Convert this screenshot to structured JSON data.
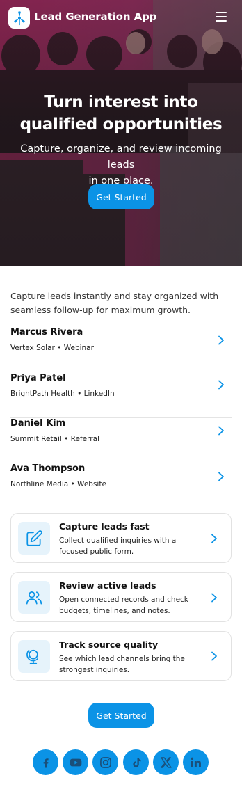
{
  "header": {
    "app_title": "Lead Generation App",
    "logo_icon": "windmill-icon",
    "menu_icon": "hamburger-icon"
  },
  "hero": {
    "title_line1": "Turn interest into",
    "title_line2": "qualified opportunities",
    "subtitle_line1": "Capture, organize, and review incoming leads",
    "subtitle_line2": "in one place.",
    "cta_label": "Get Started"
  },
  "intro": {
    "text": "Capture leads instantly and stay organized with seamless follow-up for maximum growth."
  },
  "leads": [
    {
      "name": "Marcus Rivera",
      "meta": "Vertex Solar • Webinar"
    },
    {
      "name": "Priya Patel",
      "meta": "BrightPath Health • LinkedIn"
    },
    {
      "name": "Daniel Kim",
      "meta": "Summit Retail • Referral"
    },
    {
      "name": "Ava Thompson",
      "meta": "Northline Media • Website"
    }
  ],
  "features": [
    {
      "icon": "edit-pen-icon",
      "title": "Capture leads fast",
      "desc": "Collect qualified inquiries with a focused public form."
    },
    {
      "icon": "users-icon",
      "title": "Review active leads",
      "desc": "Open connected records and check budgets, timelines, and notes."
    },
    {
      "icon": "globe-icon",
      "title": "Track source quality",
      "desc": "See which lead channels bring the strongest inquiries."
    }
  ],
  "bottom_cta": {
    "label": "Get Started"
  },
  "social": [
    "facebook-icon",
    "youtube-icon",
    "instagram-icon",
    "tiktok-icon",
    "x-icon",
    "linkedin-icon"
  ],
  "colors": {
    "accent": "#0b93e6",
    "icon_bg": "#e6f3fb",
    "text": "#111111",
    "divider": "#e4e4e4"
  }
}
